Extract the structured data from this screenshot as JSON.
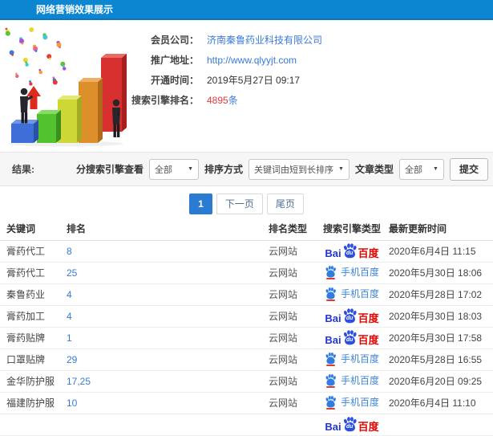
{
  "header": {
    "title": "网络营销效果展示"
  },
  "summary": {
    "rows": [
      {
        "label": "会员公司：",
        "value": "济南秦鲁药业科技有限公司",
        "style": "link"
      },
      {
        "label": "推广地址：",
        "value": "http://www.qlyyjt.com",
        "style": "link"
      },
      {
        "label": "开通时间：",
        "value": "2019年5月27日 09:17",
        "style": "plain"
      },
      {
        "label": "搜索引擎排名：",
        "value": "4895",
        "suffix": "条",
        "style": "count"
      }
    ]
  },
  "filters": {
    "result_label": "结果:",
    "engine_label": "分搜索引擎查看",
    "engine_value": "全部",
    "sort_label": "排序方式",
    "sort_value": "关键词由短到长排序",
    "type_label": "文章类型",
    "type_value": "全部",
    "submit_label": "提交",
    "caret": "▼"
  },
  "pagination": {
    "current": "1",
    "next_label": "下一页",
    "last_label": "尾页"
  },
  "table": {
    "headers": [
      "关键词",
      "排名",
      "排名类型",
      "搜索引擎类型",
      "最新更新时间"
    ],
    "rows": [
      {
        "keyword": "膏药代工",
        "rank": "8",
        "rank_type": "云网站",
        "engine": "baidu",
        "time": "2020年6月4日 11:15"
      },
      {
        "keyword": "膏药代工",
        "rank": "25",
        "rank_type": "云网站",
        "engine": "mobile-baidu",
        "time": "2020年5月30日 18:06"
      },
      {
        "keyword": "秦鲁药业",
        "rank": "4",
        "rank_type": "云网站",
        "engine": "mobile-baidu",
        "time": "2020年5月28日 17:02"
      },
      {
        "keyword": "膏药加工",
        "rank": "4",
        "rank_type": "云网站",
        "engine": "baidu",
        "time": "2020年5月30日 18:03"
      },
      {
        "keyword": "膏药贴牌",
        "rank": "1",
        "rank_type": "云网站",
        "engine": "baidu",
        "time": "2020年5月30日 17:58"
      },
      {
        "keyword": "口罩贴牌",
        "rank": "29",
        "rank_type": "云网站",
        "engine": "mobile-baidu",
        "time": "2020年5月28日 16:55"
      },
      {
        "keyword": "金华防护服",
        "rank": "17,25",
        "rank_type": "云网站",
        "engine": "mobile-baidu",
        "time": "2020年6月20日 09:25"
      },
      {
        "keyword": "福建防护服",
        "rank": "10",
        "rank_type": "云网站",
        "engine": "mobile-baidu",
        "time": "2020年6月4日 11:10"
      }
    ],
    "partial_row": {
      "engine": "baidu"
    }
  },
  "logos": {
    "baidu_bai": "Bai",
    "baidu_du": "du",
    "baidu_cn": "百度",
    "mobile_baidu": "手机百度"
  },
  "colors": {
    "titlebar_blue": "#0d86d2",
    "link_blue": "#3a7ad9",
    "count_red": "#e4393c",
    "baidu_blue": "#2335cf",
    "baidu_red": "#e10601",
    "pagination_active": "#2a7bd2"
  }
}
